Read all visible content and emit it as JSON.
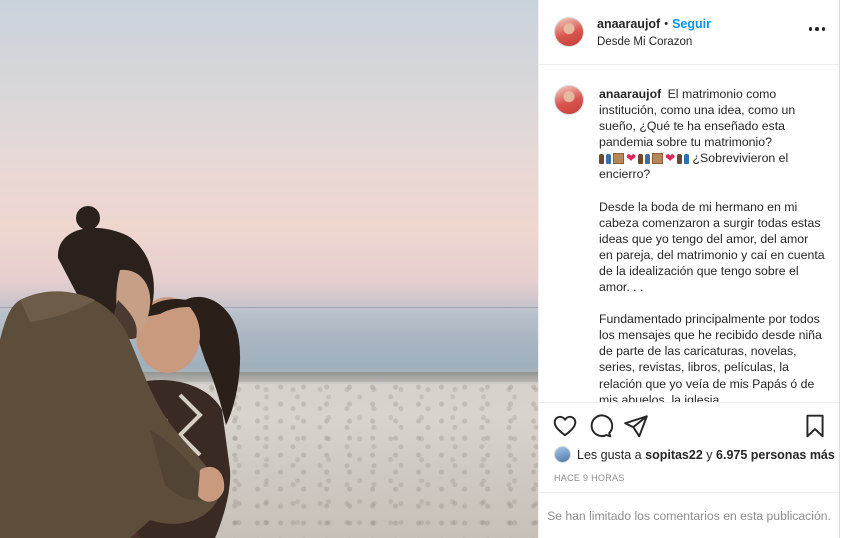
{
  "post": {
    "username": "anaaraujof",
    "follow_separator": "•",
    "follow_label": "Seguir",
    "location": "Desde Mi Corazon",
    "caption": {
      "username": "anaaraujof",
      "p1_text": "El matrimonio como institución, como una idea, como un sueño, ¿Qué te ha enseñado esta pandemia sobre tu matrimonio?",
      "p1_tail": "¿Sobrevivieron el encierro?",
      "p2": "Desde la boda de mi hermano en mi cabeza comenzaron a surgir todas estas ideas que yo tengo del amor, del amor en pareja, del matrimonio y caí en cuenta de la idealización que tengo sobre el amor. . .",
      "p3": "Fundamentado principalmente por todos los mensajes que he recibido desde niña de parte de las caricaturas, novelas, series, revistas, libros, películas, la relación que yo veía de mis Papás ó de mis abuelos, la iglesia"
    },
    "emojis": [
      "couple-icon",
      "box-icon",
      "red-heart-icon",
      "couple-icon",
      "box-icon",
      "red-heart-icon",
      "couple-icon"
    ],
    "likes": {
      "prefix": "Les gusta a",
      "user": "sopitas22",
      "joiner": "y",
      "count": "6.975 personas más"
    },
    "time_ago": "HACE 9 HORAS",
    "comments_disabled": "Se han limitado los comentarios en esta publicación."
  },
  "colors": {
    "follow": "#0095f6",
    "heart_emoji": "#e0245e",
    "muted_text": "#8e8e8e"
  }
}
